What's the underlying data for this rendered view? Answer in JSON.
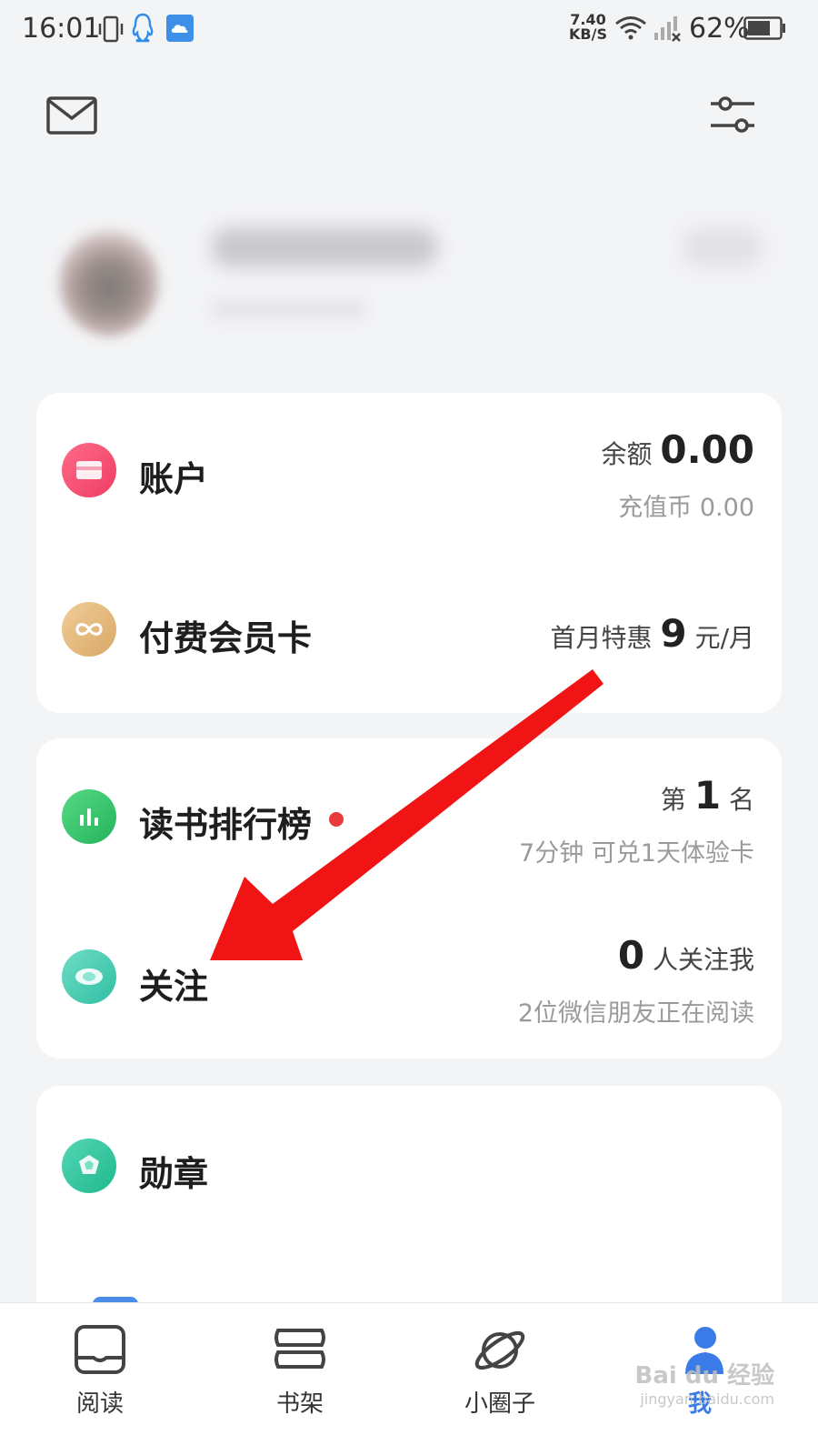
{
  "status_bar": {
    "time": "16:01",
    "net_speed_value": "7.40",
    "net_speed_unit": "KB/S",
    "battery": "62%",
    "icons": [
      "vibrate-icon",
      "qq-icon",
      "cloud-icon",
      "wifi-icon",
      "signal-icon",
      "battery-icon"
    ]
  },
  "header": {
    "icons": [
      "mail-icon",
      "filter-settings-icon"
    ]
  },
  "account_card": {
    "account": {
      "label": "账户",
      "balance_label": "余额",
      "balance_value": "0.00",
      "coins": "充值币 0.00",
      "icon": "wallet-icon",
      "icon_color": "#f0466a"
    },
    "membership": {
      "label": "付费会员卡",
      "promo_prefix": "首月特惠",
      "promo_price": "9",
      "promo_suffix": "元/月",
      "icon": "infinity-icon",
      "icon_color": "#e8bd82"
    }
  },
  "social_card": {
    "ranking": {
      "label": "读书排行榜",
      "rank_prefix": "第",
      "rank_value": "1",
      "rank_suffix": "名",
      "sub": "7分钟 可兑1天体验卡",
      "icon": "bar-chart-icon",
      "icon_color": "#34c46e",
      "has_badge": true
    },
    "follow": {
      "label": "关注",
      "followers_value": "0",
      "followers_suffix": "人关注我",
      "sub": "2位微信朋友正在阅读",
      "icon": "eye-icon",
      "icon_color": "#3fc8b0"
    }
  },
  "medal_card": {
    "medal": {
      "label": "勋章",
      "icon": "medal-icon",
      "icon_color": "#2fc4a0"
    }
  },
  "bottom_nav": {
    "items": [
      {
        "label": "阅读",
        "icon": "book-open-icon"
      },
      {
        "label": "书架",
        "icon": "bookshelf-icon"
      },
      {
        "label": "小圈子",
        "icon": "planet-icon"
      },
      {
        "label": "我",
        "icon": "profile-icon",
        "active": true
      }
    ]
  },
  "watermark": {
    "brand": "Bai du 经验",
    "url": "jingyan.baidu.com"
  },
  "colors": {
    "accent_blue": "#3a7be8",
    "annotation_red": "#f01414",
    "background": "#f3f4f6"
  }
}
